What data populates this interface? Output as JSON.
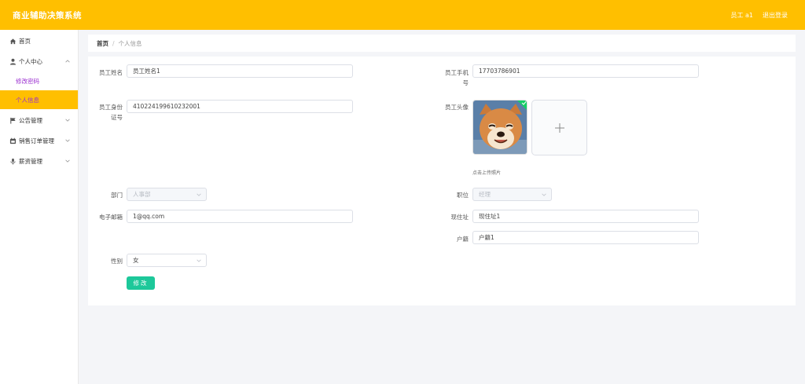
{
  "header": {
    "title": "商业辅助决策系统",
    "user": "员工 a1",
    "logout": "退出登录"
  },
  "sidebar": {
    "items": [
      {
        "label": "首页",
        "icon": "home-icon"
      },
      {
        "label": "个人中心",
        "icon": "user-icon"
      },
      {
        "label": "公告管理",
        "icon": "flag-icon"
      },
      {
        "label": "销售订单管理",
        "icon": "calendar-icon"
      },
      {
        "label": "薪资管理",
        "icon": "mic-icon"
      }
    ],
    "sub": [
      {
        "label": "修改密码"
      },
      {
        "label": "个人信息"
      }
    ]
  },
  "breadcrumb": {
    "home": "首页",
    "current": "个人信息"
  },
  "form": {
    "name_label": "员工姓名",
    "name_value": "员工姓名1",
    "phone_label_1": "员工手机",
    "phone_label_2": "号",
    "phone_value": "17703786901",
    "id_label_1": "员工身份",
    "id_label_2": "证号",
    "id_value": "410224199610232001",
    "avatar_label": "员工头像",
    "upload_tip": "点击上传照片",
    "dept_label": "部门",
    "dept_value": "人事部",
    "position_label": "职位",
    "position_value": "经理",
    "email_label": "电子邮箱",
    "email_value": "1@qq.com",
    "address_label": "现住址",
    "address_value": "现住址1",
    "hukou_label": "户籍",
    "hukou_value": "户籍1",
    "gender_label": "性别",
    "gender_value": "女",
    "submit_label": "修改"
  },
  "colors": {
    "accent": "#ffbf00",
    "button": "#1dc89a",
    "submenu_text": "#9b30d0"
  }
}
